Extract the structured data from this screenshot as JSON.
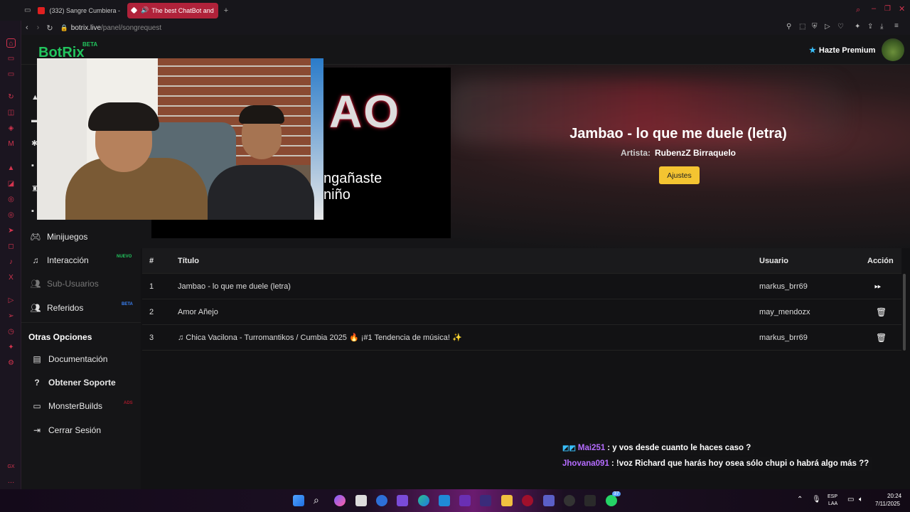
{
  "browser": {
    "tabs": [
      {
        "label": "(332) Sangre Cumbiera -",
        "active": false
      },
      {
        "label": "The best ChatBot and",
        "active": true
      }
    ],
    "url_host": "botrix.live",
    "url_path": "/panel/songrequest"
  },
  "app": {
    "brand": "BotRix",
    "brand_tag": "BETA",
    "premium_label": "Hazte Premium"
  },
  "sidebar": {
    "items": [
      {
        "label": "Minijuegos",
        "icon": "gamepad-icon",
        "tag": ""
      },
      {
        "label": "Interacción",
        "icon": "music-icon",
        "tag": "NUEVO"
      },
      {
        "label": "Sub-Usuarios",
        "icon": "users-icon",
        "tag": ""
      },
      {
        "label": "Referidos",
        "icon": "users-icon",
        "tag": "BETA"
      }
    ],
    "other_heading": "Otras Opciones",
    "other_items": [
      {
        "label": "Documentación",
        "icon": "book-icon",
        "tag": ""
      },
      {
        "label": "Obtener Soporte",
        "icon": "question-icon",
        "tag": ""
      },
      {
        "label": "MonsterBuilds",
        "icon": "laptop-icon",
        "tag": "ADS"
      },
      {
        "label": "Cerrar Sesión",
        "icon": "logout-icon",
        "tag": ""
      }
    ]
  },
  "now_playing": {
    "title": "Jambao - lo que me duele (letra)",
    "artist_label": "Artista:",
    "artist": "RubenzZ Birraquelo",
    "settings_button": "Ajustes",
    "art_text_line1": "ngañaste",
    "art_text_line2": "niño",
    "art_logo": "AO"
  },
  "queue": {
    "headers": {
      "num": "#",
      "title": "Título",
      "user": "Usuario",
      "action": "Acción"
    },
    "rows": [
      {
        "num": "1",
        "title": "Jambao - lo que me duele (letra)",
        "user": "markus_brr69",
        "action": "skip"
      },
      {
        "num": "2",
        "title": "Amor Añejo",
        "user": "may_mendozx",
        "action": "delete"
      },
      {
        "num": "3",
        "title": "♫ Chica Vacilona - Turromantikos / Cumbia 2025 🔥 ¡#1 Tendencia de música! ✨",
        "user": "markus_brr69",
        "action": "delete"
      }
    ]
  },
  "chat": [
    {
      "user": "Mai251",
      "message": ": y vos desde cuanto le haces caso ?",
      "color": "#b56cff"
    },
    {
      "user": "Jhovana091",
      "message": ": !voz Richard que harás hoy osea sólo chupi o habrá algo más ??",
      "color": "#b56cff"
    }
  ],
  "taskbar": {
    "lang1": "ESP",
    "lang2": "LAA",
    "time": "20:24",
    "date": "7/11/2025",
    "badge": "37"
  },
  "colors": {
    "accent_red": "#b0223a",
    "brand_green": "#22c55e",
    "settings_yellow": "#f4c431"
  }
}
